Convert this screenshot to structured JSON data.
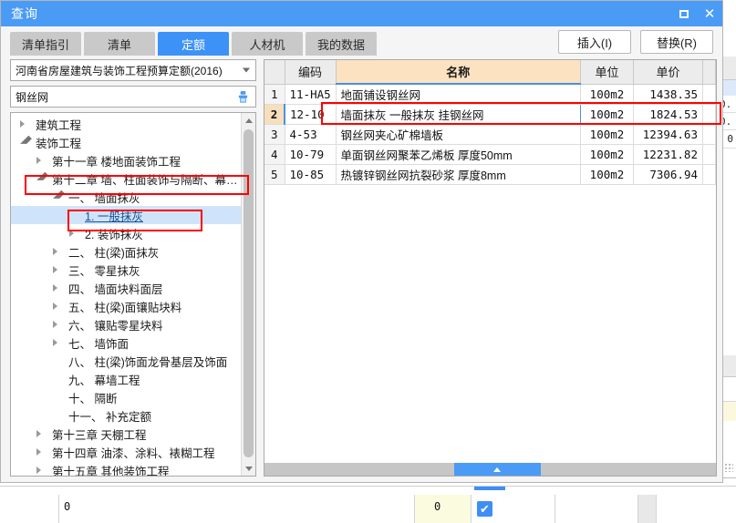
{
  "window": {
    "title": "查询",
    "maximize_label": "□",
    "close_label": "✕"
  },
  "tabs": [
    {
      "label": "清单指引",
      "active": false
    },
    {
      "label": "清单",
      "active": false
    },
    {
      "label": "定额",
      "active": true
    },
    {
      "label": "人材机",
      "active": false
    },
    {
      "label": "我的数据",
      "active": false
    }
  ],
  "toolbar": {
    "insert_label": "插入(I)",
    "replace_label": "替换(R)"
  },
  "left": {
    "library_select": "河南省房屋建筑与装饰工程预算定额(2016)",
    "search_value": "钢丝网",
    "search_placeholder": "",
    "clear_icon": "brush-icon",
    "tree": [
      {
        "label": "建筑工程",
        "indent": 0,
        "state": "collapsed",
        "selected": false
      },
      {
        "label": "装饰工程",
        "indent": 0,
        "state": "expanded",
        "selected": false
      },
      {
        "label": "第十一章 楼地面装饰工程",
        "indent": 1,
        "state": "collapsed",
        "selected": false
      },
      {
        "label": "第十二章 墙、柱面装饰与隔断、幕…",
        "indent": 1,
        "state": "expanded",
        "selected": false,
        "highlight": true
      },
      {
        "label": "一、 墙面抹灰",
        "indent": 2,
        "state": "expanded",
        "selected": false
      },
      {
        "label": "1. 一般抹灰",
        "indent": 3,
        "state": "none",
        "selected": true,
        "highlight": true
      },
      {
        "label": "2. 装饰抹灰",
        "indent": 3,
        "state": "collapsed",
        "selected": false
      },
      {
        "label": "二、 柱(梁)面抹灰",
        "indent": 2,
        "state": "collapsed",
        "selected": false
      },
      {
        "label": "三、 零星抹灰",
        "indent": 2,
        "state": "collapsed",
        "selected": false
      },
      {
        "label": "四、 墙面块料面层",
        "indent": 2,
        "state": "collapsed",
        "selected": false
      },
      {
        "label": "五、 柱(梁)面镶贴块料",
        "indent": 2,
        "state": "collapsed",
        "selected": false
      },
      {
        "label": "六、 镶贴零星块料",
        "indent": 2,
        "state": "collapsed",
        "selected": false
      },
      {
        "label": "七、 墙饰面",
        "indent": 2,
        "state": "collapsed",
        "selected": false
      },
      {
        "label": "八、 柱(梁)饰面龙骨基层及饰面",
        "indent": 2,
        "state": "none",
        "selected": false
      },
      {
        "label": "九、 幕墙工程",
        "indent": 2,
        "state": "none",
        "selected": false
      },
      {
        "label": "十、 隔断",
        "indent": 2,
        "state": "none",
        "selected": false
      },
      {
        "label": "十一、 补充定额",
        "indent": 2,
        "state": "none",
        "selected": false
      },
      {
        "label": "第十三章 天棚工程",
        "indent": 1,
        "state": "collapsed",
        "selected": false
      },
      {
        "label": "第十四章 油漆、涂料、裱糊工程",
        "indent": 1,
        "state": "collapsed",
        "selected": false
      },
      {
        "label": "第十五章 其他装饰工程",
        "indent": 1,
        "state": "collapsed",
        "selected": false
      }
    ]
  },
  "grid": {
    "columns": [
      "",
      "编码",
      "名称",
      "单位",
      "单价"
    ],
    "rows": [
      {
        "idx": "1",
        "code": "11-HA5",
        "name": "地面铺设钢丝网",
        "unit": "100m2",
        "price": "1438.35",
        "selected": false
      },
      {
        "idx": "2",
        "code": "12-10",
        "name": "墙面抹灰  一般抹灰  挂钢丝网",
        "unit": "100m2",
        "price": "1824.53",
        "selected": true
      },
      {
        "idx": "3",
        "code": "4-53",
        "name": "钢丝网夹心矿棉墙板",
        "unit": "100m2",
        "price": "12394.63",
        "selected": false
      },
      {
        "idx": "4",
        "code": "10-79",
        "name": "单面钢丝网聚苯乙烯板  厚度50mm",
        "unit": "100m2",
        "price": "12231.82",
        "selected": false
      },
      {
        "idx": "5",
        "code": "10-85",
        "name": "热镀锌钢丝网抗裂砂浆  厚度8mm",
        "unit": "100m2",
        "price": "7306.94",
        "selected": false
      }
    ]
  },
  "background": {
    "bottom_value_left": "0",
    "bottom_value_right": "0",
    "checkbox_checked": "✔",
    "right_col_values": [
      "0.",
      "0.",
      "0"
    ]
  },
  "colors": {
    "accent": "#3d92f7",
    "title_bar": "#4a9bf5",
    "tab_inactive": "#c9c9c9",
    "name_header": "#fce2c0",
    "annotation": "#ff0000",
    "selection": "#cfe4fb"
  }
}
